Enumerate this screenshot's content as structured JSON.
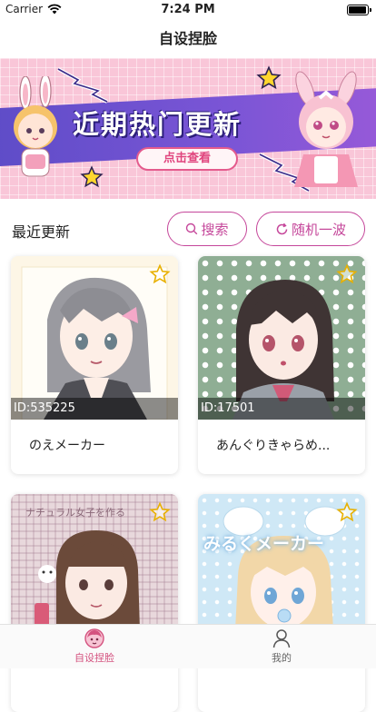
{
  "status_bar": {
    "carrier": "Carrier",
    "time": "7:24 PM"
  },
  "nav": {
    "title": "自设捏脸"
  },
  "banner": {
    "title": "近期热门更新",
    "button_label": "点击查看"
  },
  "section": {
    "title": "最近更新",
    "search_label": "搜索",
    "random_label": "随机一波"
  },
  "cards": [
    {
      "id": "ID:535225",
      "name": "のえメーカー",
      "favorited": false
    },
    {
      "id": "ID:17501",
      "name": "あんぐりきゃらめ...",
      "favorited": false
    },
    {
      "id": "",
      "name": "",
      "image_text": "ナチュラル女子を作る",
      "favorited": false
    },
    {
      "id": "",
      "name": "",
      "image_text": "みるくメーカー",
      "favorited": false
    }
  ],
  "tabs": [
    {
      "label": "自设捏脸",
      "icon": "face-icon",
      "active": true
    },
    {
      "label": "我的",
      "icon": "person-icon",
      "active": false
    }
  ],
  "colors": {
    "accent": "#c5469a",
    "tab_active": "#d4527f",
    "banner_band": "#6a50cf"
  }
}
